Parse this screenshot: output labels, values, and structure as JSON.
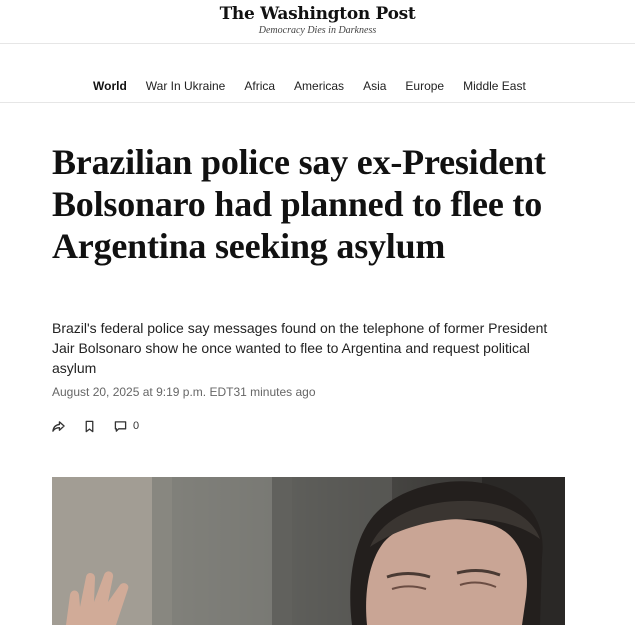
{
  "masthead": {
    "logo": "The Washington Post",
    "tagline": "Democracy Dies in Darkness"
  },
  "nav": {
    "items": [
      {
        "label": "World",
        "active": true
      },
      {
        "label": "War In Ukraine",
        "active": false
      },
      {
        "label": "Africa",
        "active": false
      },
      {
        "label": "Americas",
        "active": false
      },
      {
        "label": "Asia",
        "active": false
      },
      {
        "label": "Europe",
        "active": false
      },
      {
        "label": "Middle East",
        "active": false
      }
    ]
  },
  "article": {
    "headline": "Brazilian police say ex-President Bolsonaro had planned to flee to Argentina seeking asylum",
    "dek": "Brazil's federal police say messages found on the telephone of former President Jair Bolsonaro show he once wanted to flee to Argentina and request political asylum",
    "date": "August 20, 2025 at 9:19 p.m. EDT",
    "relative_time": "31 minutes ago",
    "comment_count": "0"
  },
  "icons": {
    "share": "share-icon",
    "save": "bookmark-icon",
    "comments": "comment-icon"
  }
}
